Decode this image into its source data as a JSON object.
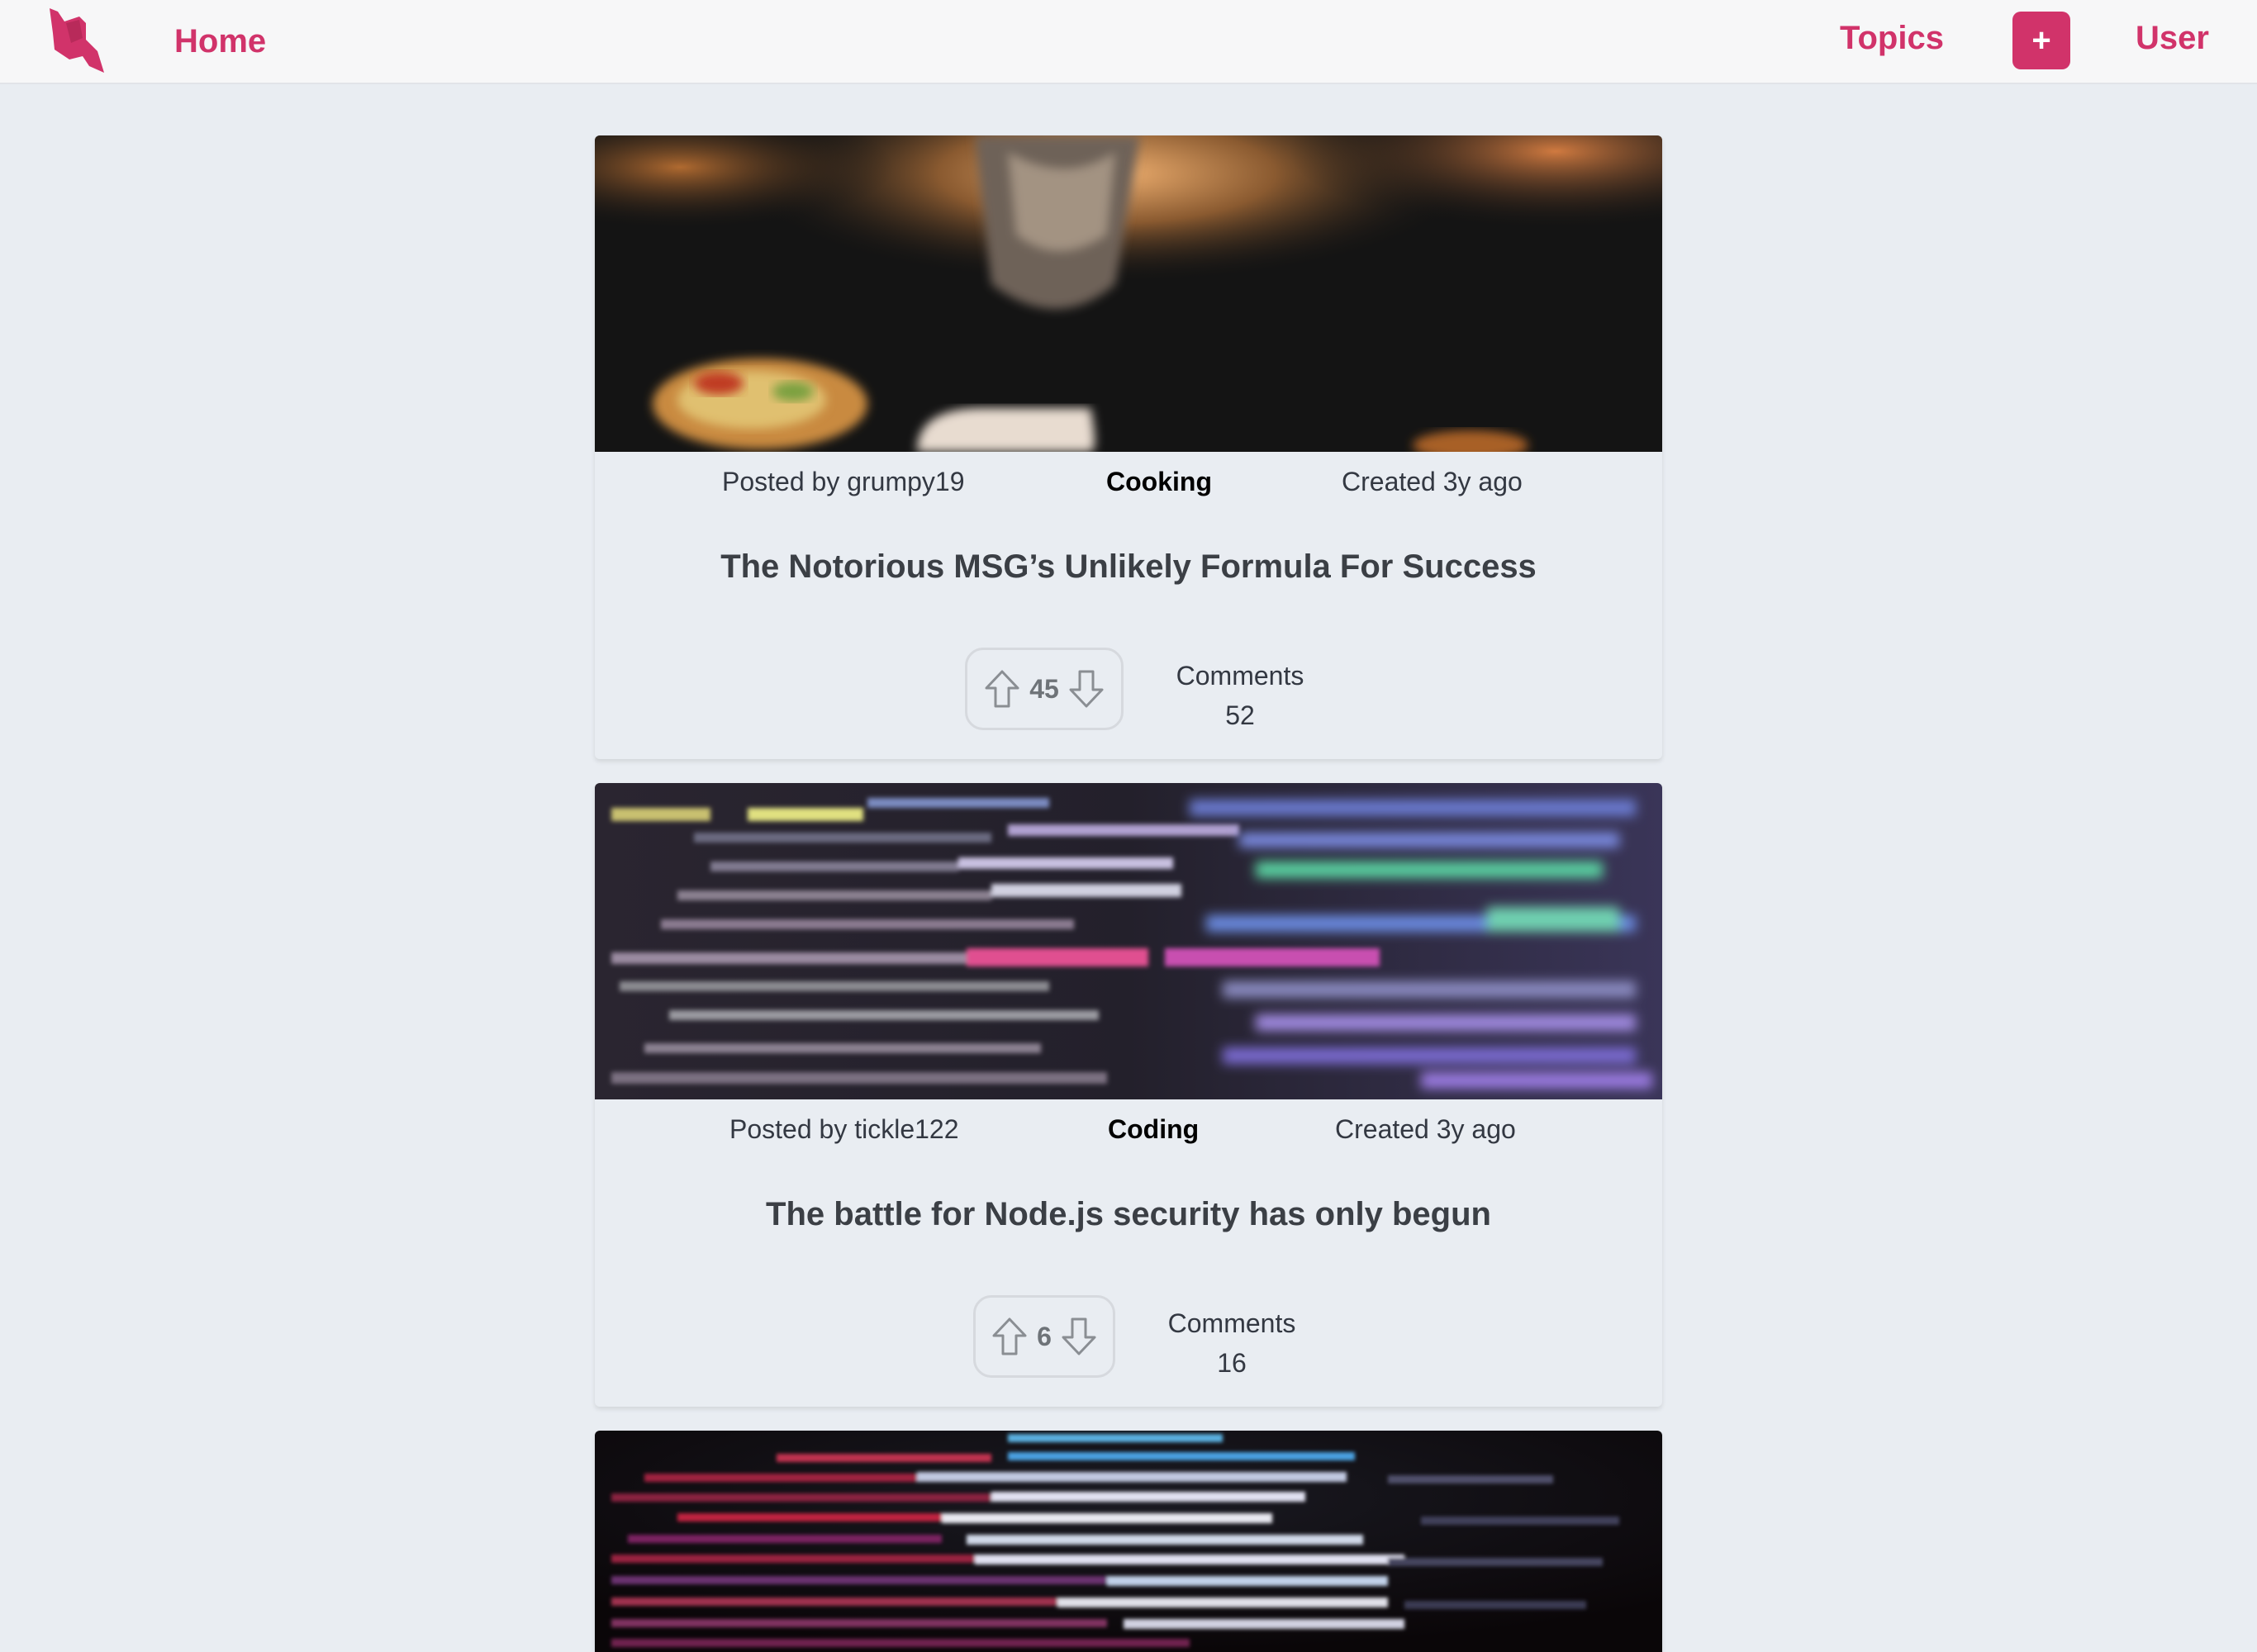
{
  "colors": {
    "accent": "#d1336a",
    "page_background": "#e9edf2",
    "header_background": "#f7f7f8"
  },
  "header": {
    "logo_icon": "book-logo-icon",
    "home_label": "Home",
    "topics_label": "Topics",
    "add_label": "+",
    "user_label": "User"
  },
  "posts": [
    {
      "image": "cooking-photo",
      "posted_by": "Posted by grumpy19",
      "topic": "Cooking",
      "created": "Created 3y ago",
      "title": "The Notorious MSG’s Unlikely Formula For Success",
      "votes": "45",
      "comments_label": "Comments",
      "comments_count": "52"
    },
    {
      "image": "code-photo",
      "posted_by": "Posted by tickle122",
      "topic": "Coding",
      "created": "Created 3y ago",
      "title": "The battle for Node.js security has only begun",
      "votes": "6",
      "comments_label": "Comments",
      "comments_count": "16"
    },
    {
      "image": "code-photo-dark"
    }
  ]
}
